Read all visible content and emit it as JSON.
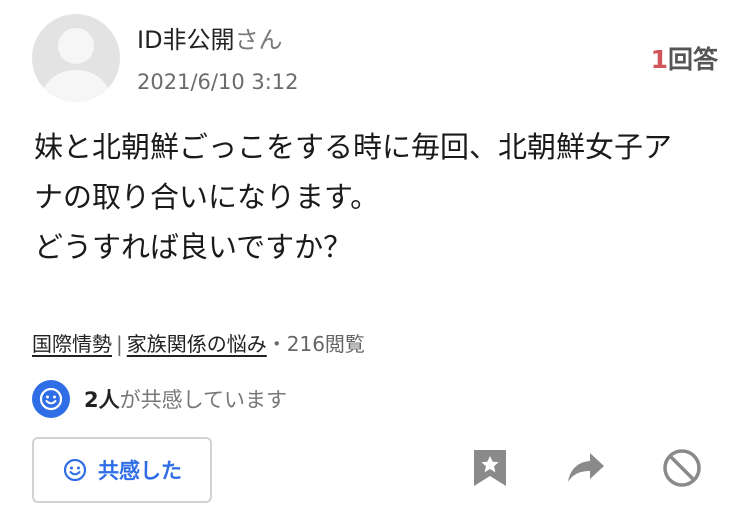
{
  "user": {
    "name": "ID非公開",
    "suffix": "さん",
    "date": "2021/6/10 3:12"
  },
  "answers": {
    "count": "1",
    "label": "回答"
  },
  "question": {
    "lines": [
      "妹と北朝鮮ごっこをする時に毎回、北朝鮮女子ア",
      "ナの取り合いになります。",
      "どうすれば良いですか？"
    ]
  },
  "tags": {
    "category1": "国際情勢",
    "separator": "|",
    "category2": "家族関係の悩み",
    "views": "・216閲覧"
  },
  "empathy": {
    "count": "2人",
    "text": "が共感しています",
    "icon": "smile-icon"
  },
  "actions": {
    "kyokan_label": "共感した",
    "bookmark_icon": "bookmark-star-icon",
    "share_icon": "share-arrow-icon",
    "block_icon": "prohibited-icon"
  },
  "colors": {
    "accent": "#2f6ee7",
    "answer_count": "#d2555a"
  }
}
